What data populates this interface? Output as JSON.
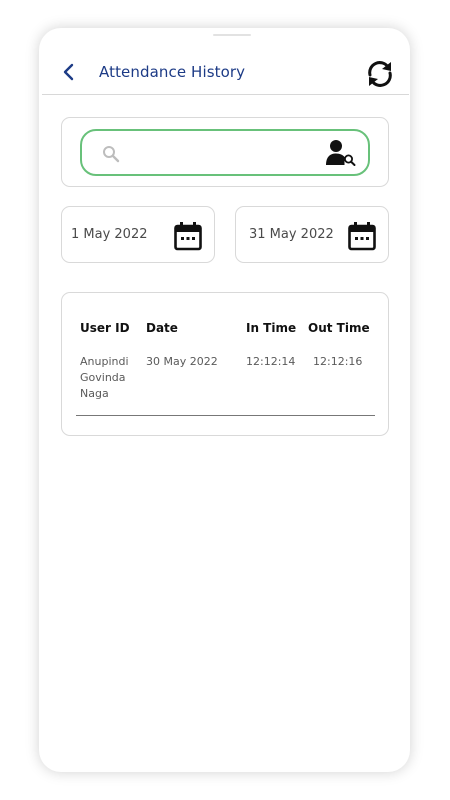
{
  "header": {
    "title": "Attendance History",
    "back_icon": "chevron-left-icon",
    "refresh_icon": "refresh-icon"
  },
  "search": {
    "placeholder": "",
    "value": "",
    "search_icon": "search-icon",
    "user_search_icon": "user-search-icon"
  },
  "filters": {
    "from_date": "1 May 2022",
    "to_date": "31 May 2022",
    "calendar_icon": "calendar-icon"
  },
  "table": {
    "columns": [
      "User ID",
      "Date",
      "In Time",
      "Out Time"
    ],
    "rows": [
      {
        "user_id": "Anupindi Govinda Naga",
        "date": "30 May 2022",
        "in_time": "12:12:14",
        "out_time": "12:12:16"
      }
    ]
  },
  "colors": {
    "title": "#1d3b86",
    "search_border": "#68c17a",
    "card_border": "#d9d9d9"
  }
}
